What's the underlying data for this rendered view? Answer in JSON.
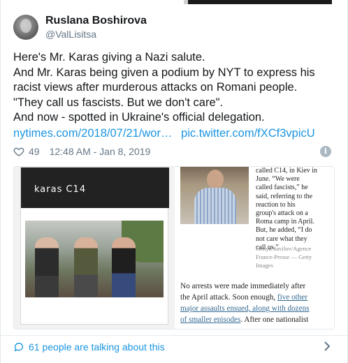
{
  "user": {
    "display_name": "Ruslana Boshirova",
    "handle": "@ValLisitsa"
  },
  "tweet": {
    "lines": [
      "Here's Mr. Karas giving a Nazi salute.",
      "And Mr. Karas being given a podium by NYT to express his",
      "racist views after murderous attacks on Romani people.",
      "\"They call us fascists. But we don't care\".",
      "And now - spotted in Ukraine's official delegation."
    ],
    "link_1": "nytimes.com/2018/07/21/wor…",
    "link_2": "pic.twitter.com/fXCf3vpicU",
    "like_count": "49",
    "timestamp": "12:48 AM - Jan 8, 2019"
  },
  "media": {
    "card_title": "karas C14",
    "article_column": [
      "called C14, in Kiev in",
      "June. “We were",
      "called fascists,” he",
      "said, referring to the",
      "reaction to his",
      "group's attack on a",
      "Roma camp in April.",
      "But, he added, “I do",
      "not care what they",
      "call us.”"
    ],
    "caption_lines": [
      "Genya Savilov/Agence",
      "France-Presse — Getty",
      "Images"
    ],
    "body": {
      "l1": "No arrests were made immediately after",
      "l2_plain": "the April attack. Soon enough, ",
      "l2_link": "five other",
      "l3_link": "major assaults ensued, along with dozens",
      "l4_link": "of smaller episodes",
      "l4_plain": ". After one nationalist"
    }
  },
  "footer": {
    "talking_label": "61 people are talking about this"
  },
  "colors": {
    "link": "#1b95e0",
    "muted": "#657786",
    "text": "#14171a"
  },
  "icons": [
    "heart-icon",
    "info-icon",
    "chat-bubble-icon",
    "chevron-right-icon"
  ]
}
